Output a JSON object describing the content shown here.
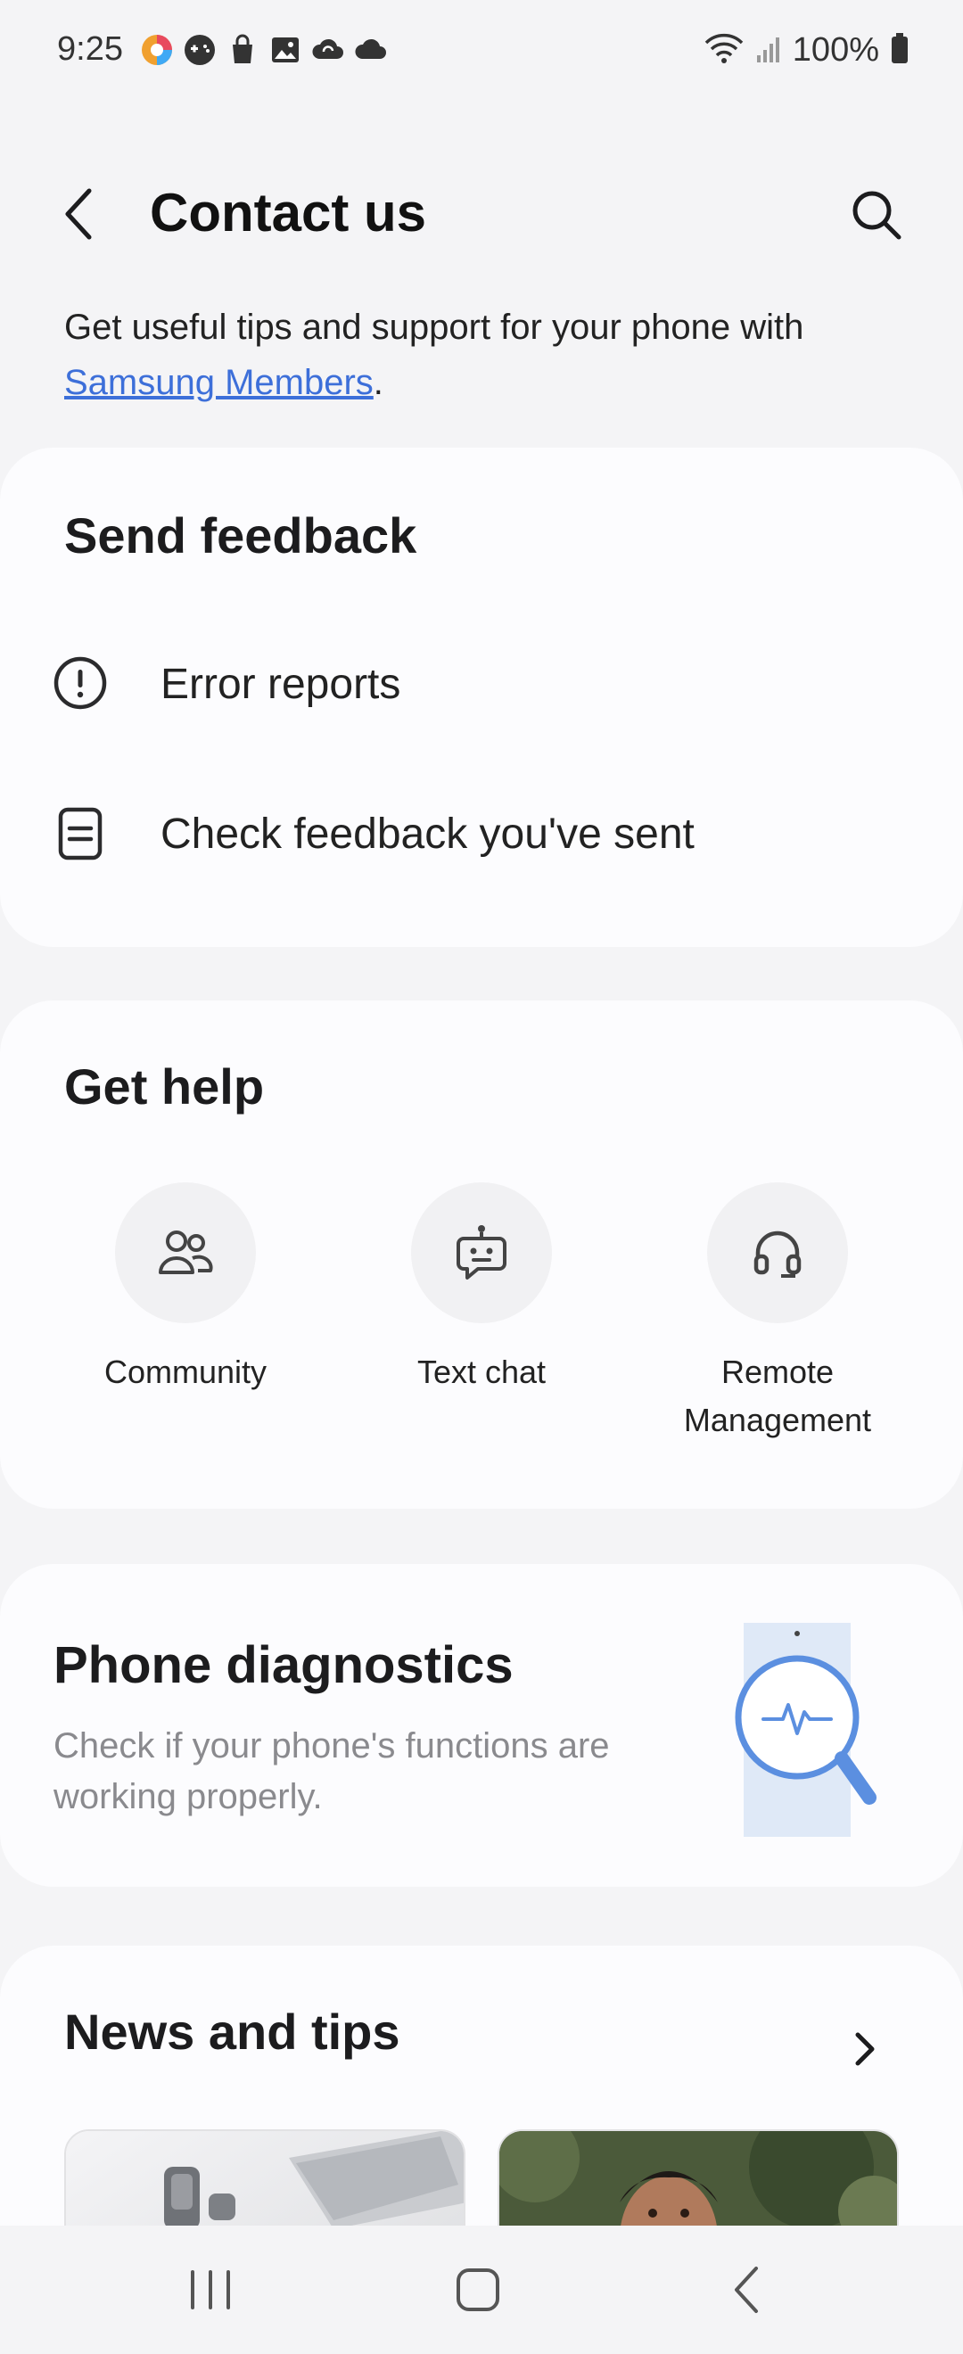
{
  "status_bar": {
    "time": "9:25",
    "battery": "100%"
  },
  "header": {
    "title": "Contact us"
  },
  "intro": {
    "text": "Get useful tips and support for your phone with",
    "link": "Samsung Members",
    "suffix": "."
  },
  "send_feedback": {
    "title": "Send feedback",
    "items": [
      {
        "label": "Error reports",
        "icon": "alert-circle-icon"
      },
      {
        "label": "Check feedback you've sent",
        "icon": "document-icon"
      }
    ]
  },
  "get_help": {
    "title": "Get help",
    "items": [
      {
        "label": "Community",
        "icon": "people-icon"
      },
      {
        "label": "Text chat",
        "icon": "chat-bot-icon"
      },
      {
        "label": "Remote Management",
        "icon": "headset-icon"
      }
    ]
  },
  "diagnostics": {
    "title": "Phone diagnostics",
    "description": "Check if your phone's functions are working properly."
  },
  "news": {
    "title": "News and tips"
  },
  "colors": {
    "link": "#3d6fd9",
    "accent": "#4a86e8",
    "card": "#fcfcfe",
    "background": "#f4f4f6"
  }
}
